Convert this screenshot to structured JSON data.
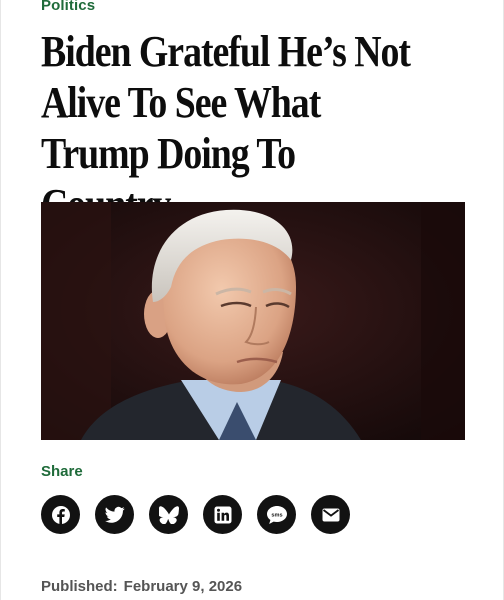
{
  "article": {
    "section": "Politics",
    "headline": "Biden Grateful He’s Not Alive To See What Trump Doing To Country",
    "published_label": "Published:",
    "published_date": "February 9, 2026"
  },
  "share": {
    "label": "Share",
    "buttons": [
      {
        "icon": "facebook-icon"
      },
      {
        "icon": "twitter-icon"
      },
      {
        "icon": "bluesky-icon"
      },
      {
        "icon": "linkedin-icon"
      },
      {
        "icon": "sms-icon",
        "text": "sms"
      },
      {
        "icon": "email-icon"
      }
    ]
  },
  "colors": {
    "section_green": "#1f6b3a",
    "share_button_bg": "#121212",
    "headline_text": "#0d0d0d",
    "published_text": "#555555"
  }
}
